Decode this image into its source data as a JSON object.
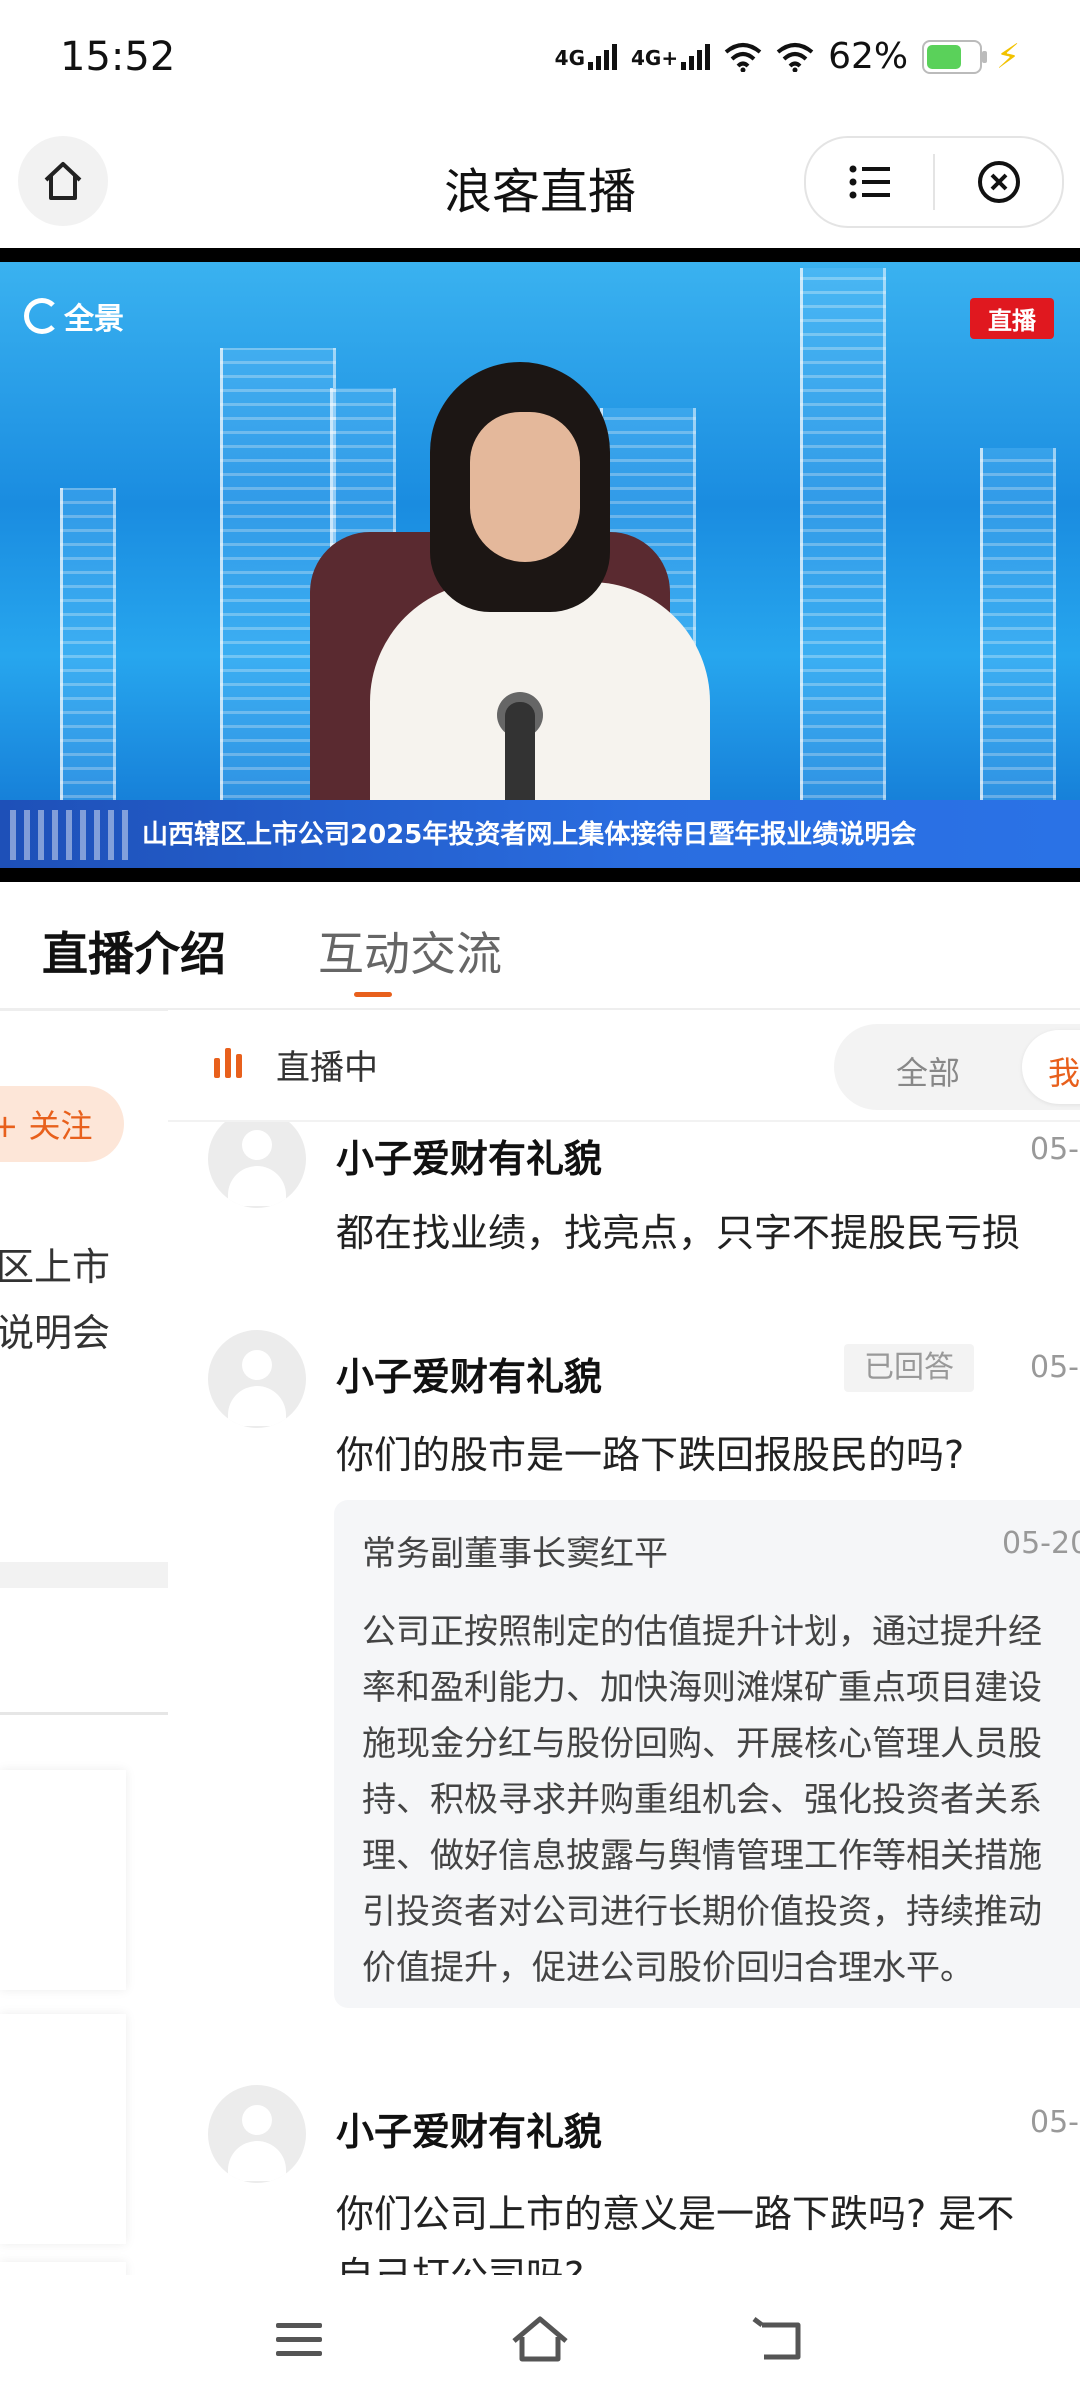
{
  "status_bar": {
    "time": "15:52",
    "net1": "4G",
    "net2": "4G+",
    "battery": "62%",
    "icons": [
      "signal-icon",
      "wifi-icon",
      "battery-icon",
      "charging-icon"
    ]
  },
  "header": {
    "title": "浪客直播"
  },
  "video": {
    "logo": "全景",
    "live_badge": "直播",
    "banner": "山西辖区上市公司2025年投资者网上集体接待日暨年报业绩说明会"
  },
  "tabs": {
    "intro": "直播介绍",
    "chat": "互动交流",
    "active": "chat"
  },
  "left_panel": {
    "follow": "+ 关注",
    "line1": "区上市",
    "line2": "说明会"
  },
  "chat": {
    "live_status": "直播中",
    "filter_all": "全部",
    "filter_mine": "我",
    "messages": [
      {
        "user": "小子爱财有礼貌",
        "date": "05-",
        "text": "都在找业绩，找亮点，只字不提股民亏损"
      },
      {
        "user": "小子爱财有礼貌",
        "badge": "已回答",
        "date": "05-",
        "text": "你们的股市是一路下跌回报股民的吗?",
        "reply": {
          "name": "常务副董事长窦红平",
          "date": "05-20",
          "lines": [
            "公司正按照制定的估值提升计划，通过提升经",
            "率和盈利能力、加快海则滩煤矿重点项目建设",
            "施现金分红与股份回购、开展核心管理人员股",
            "持、积极寻求并购重组机会、强化投资者关系",
            "理、做好信息披露与舆情管理工作等相关措施",
            "引投资者对公司进行长期价值投资，持续推动",
            "价值提升，促进公司股价回归合理水平。"
          ]
        }
      },
      {
        "user": "小子爱财有礼貌",
        "date": "05-",
        "text": "你们公司上市的意义是一路下跌吗? 是不",
        "text2": "自己打公司吗?"
      }
    ]
  }
}
